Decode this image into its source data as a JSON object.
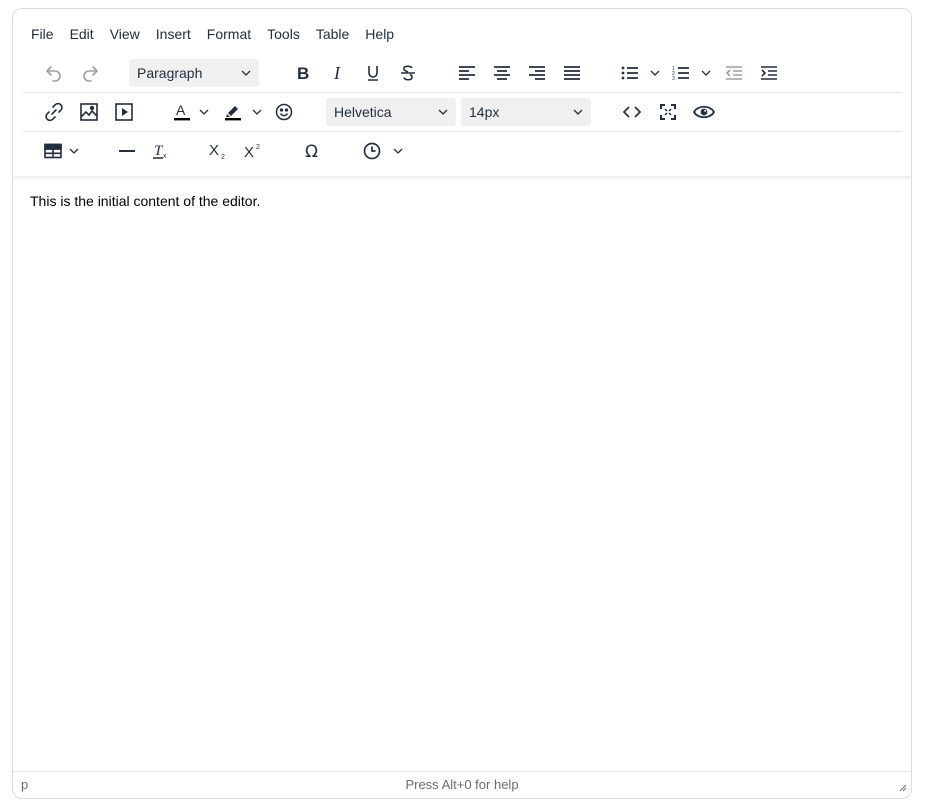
{
  "menubar": {
    "items": [
      "File",
      "Edit",
      "View",
      "Insert",
      "Format",
      "Tools",
      "Table",
      "Help"
    ]
  },
  "toolbar": {
    "block_format": "Paragraph",
    "font_family": "Helvetica",
    "font_size": "14px"
  },
  "icons": {
    "undo": "undo-icon",
    "redo": "redo-icon",
    "bold": "bold-icon",
    "italic": "italic-icon",
    "underline": "underline-icon",
    "strikethrough": "strikethrough-icon",
    "align_left": "align-left-icon",
    "align_center": "align-center-icon",
    "align_right": "align-right-icon",
    "align_justify": "align-justify-icon",
    "bullet_list": "bullet-list-icon",
    "numbered_list": "numbered-list-icon",
    "outdent": "outdent-icon",
    "indent": "indent-icon",
    "link": "link-icon",
    "image": "image-icon",
    "media": "media-icon",
    "text_color": "text-color-icon",
    "highlight": "highlight-icon",
    "emoji": "emoji-icon",
    "code": "code-icon",
    "fullscreen": "fullscreen-icon",
    "preview": "eye-icon",
    "table": "table-icon",
    "hr": "horizontal-line-icon",
    "clear_format": "clear-format-icon",
    "subscript": "subscript-icon",
    "superscript": "superscript-icon",
    "charmap": "omega-icon",
    "datetime": "clock-icon"
  },
  "colors": {
    "icon": "#222f3e",
    "select_bg": "#f0f0f0",
    "border": "#dcdcdc",
    "text_color_bar": "#000000"
  },
  "content": {
    "text": "This is the initial content of the editor."
  },
  "statusbar": {
    "path": "p",
    "help": "Press Alt+0 for help"
  }
}
